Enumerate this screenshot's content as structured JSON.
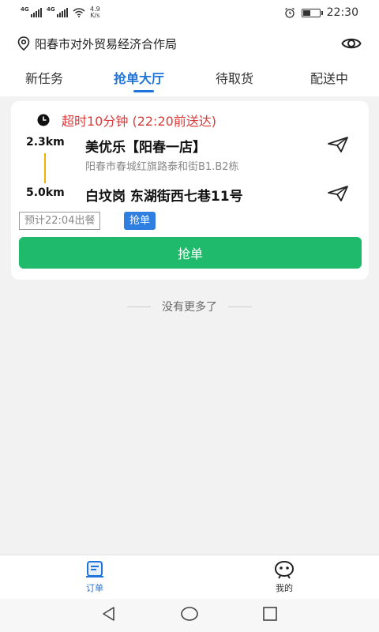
{
  "status_bar": {
    "sim1": "4G",
    "sim2": "4G",
    "speed_value": "4.9",
    "speed_unit": "K/s",
    "time": "22:30",
    "battery_level": 0.45
  },
  "header": {
    "location": "阳春市对外贸易经济合作局",
    "location_icon": "map-pin-icon",
    "right_icon": "eye-icon"
  },
  "tabs": [
    {
      "label": "新任务"
    },
    {
      "label": "抢单大厅",
      "active": true
    },
    {
      "label": "待取货"
    },
    {
      "label": "配送中"
    }
  ],
  "order": {
    "timeout_text": "超时10分钟 (22:20前送达)",
    "pickup": {
      "distance": "2.3km",
      "name": "美优乐【阳春一店】",
      "address": "阳春市春城红旗路泰和街B1.B2栋"
    },
    "dropoff": {
      "distance": "5.0km",
      "name": "白坟岗 东湖街西七巷11号"
    },
    "eta_tag": "预计22:04出餐",
    "grab_tag": "抢单",
    "grab_button": "抢单",
    "accent_green": "#1fba6b",
    "accent_blue": "#2e7fe0"
  },
  "list_end": "没有更多了",
  "bottom_nav": [
    {
      "label": "订单",
      "icon": "order-icon",
      "active": true
    },
    {
      "label": "我的",
      "icon": "profile-face-icon"
    }
  ]
}
